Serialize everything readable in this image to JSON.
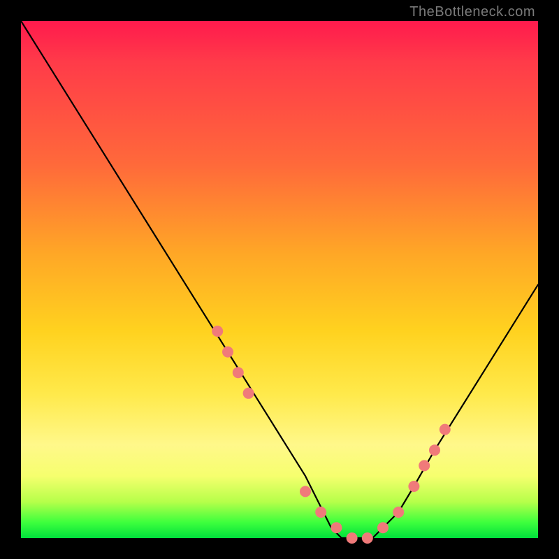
{
  "watermark": "TheBottleneck.com",
  "chart_data": {
    "type": "line",
    "title": "",
    "xlabel": "",
    "ylabel": "",
    "xlim": [
      0,
      100
    ],
    "ylim": [
      0,
      100
    ],
    "grid": false,
    "series": [
      {
        "name": "bottleneck-curve",
        "color": "#000000",
        "x": [
          0,
          5,
          10,
          15,
          20,
          25,
          30,
          35,
          40,
          45,
          50,
          55,
          58,
          60,
          62,
          65,
          68,
          70,
          73,
          76,
          80,
          85,
          90,
          95,
          100
        ],
        "y": [
          100,
          92,
          84,
          76,
          68,
          60,
          52,
          44,
          36,
          28,
          20,
          12,
          6,
          2,
          0,
          0,
          0,
          2,
          5,
          10,
          17,
          25,
          33,
          41,
          49
        ]
      }
    ],
    "markers": {
      "name": "highlight-dots",
      "color": "#f07a7a",
      "radius": 8,
      "x": [
        38,
        40,
        42,
        44,
        55,
        58,
        61,
        64,
        67,
        70,
        73,
        76,
        78,
        80,
        82
      ],
      "y": [
        40,
        36,
        32,
        28,
        9,
        5,
        2,
        0,
        0,
        2,
        5,
        10,
        14,
        17,
        21
      ]
    },
    "background_gradient": {
      "top": "#ff1a4d",
      "mid_upper": "#ffa726",
      "mid": "#ffe94a",
      "mid_lower": "#b6ff4a",
      "bottom": "#00e03c"
    }
  }
}
